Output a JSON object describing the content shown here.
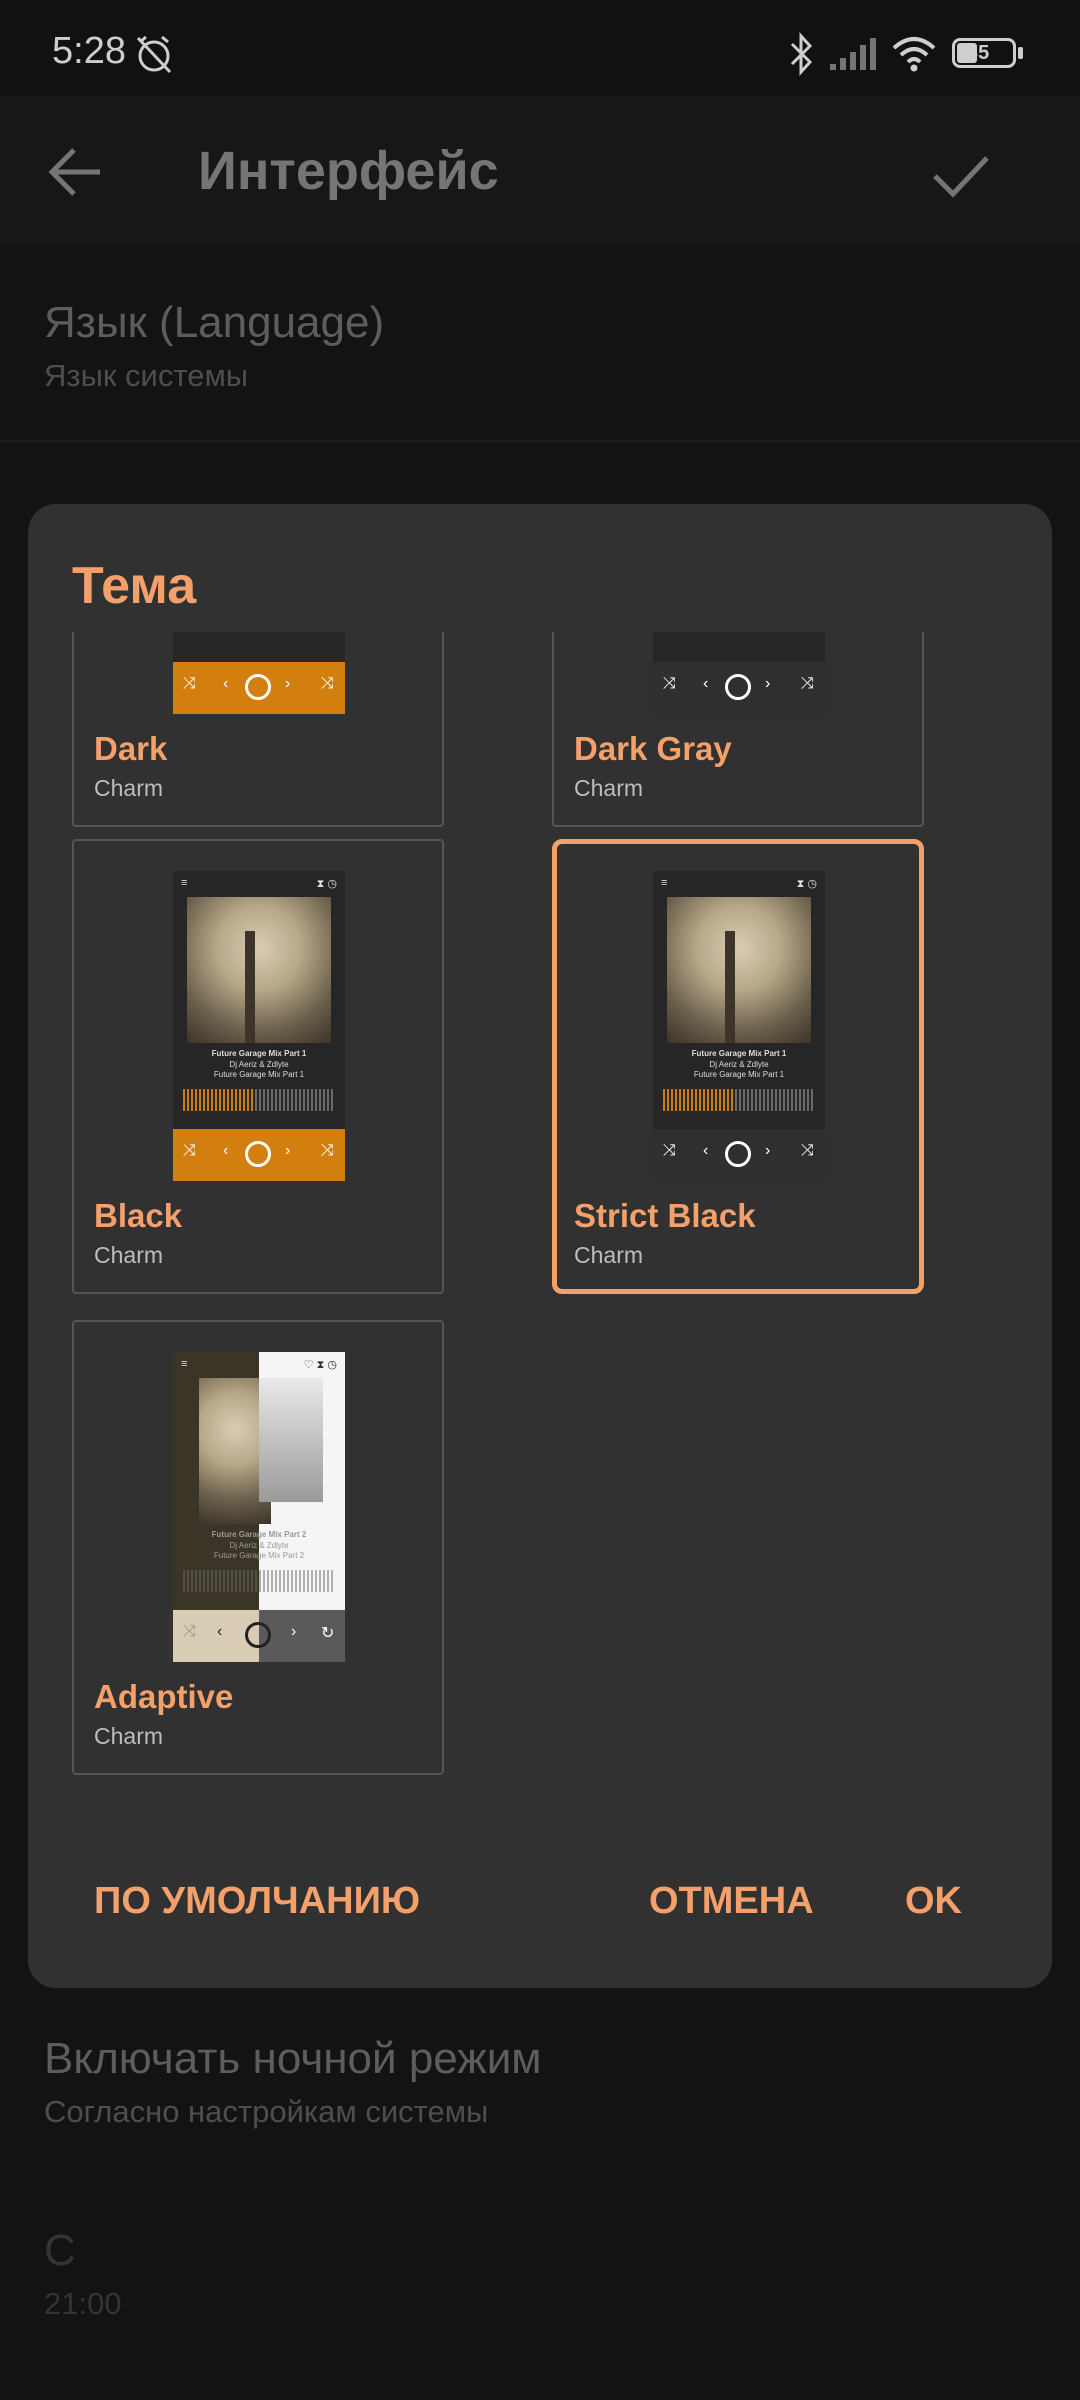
{
  "status_bar": {
    "time": "5:28",
    "battery": "35",
    "icons": [
      "alarm-off-icon",
      "bluetooth-icon",
      "signal-icon",
      "wifi-icon",
      "battery-icon"
    ]
  },
  "app_bar": {
    "title": "Интерфейс",
    "back_icon": "back-arrow-icon",
    "confirm_icon": "check-icon"
  },
  "settings": {
    "language_title": "Язык (Language)",
    "language_value": "Язык системы",
    "night_mode_title": "Включать ночной режим",
    "night_mode_value": "Согласно настройкам системы",
    "from_title": "С",
    "from_value": "21:00"
  },
  "dialog": {
    "title": "Тема",
    "themes": [
      {
        "name": "Dark",
        "author": "Charm",
        "selected": false
      },
      {
        "name": "Dark Gray",
        "author": "Charm",
        "selected": false
      },
      {
        "name": "Black",
        "author": "Charm",
        "selected": false
      },
      {
        "name": "Strict Black",
        "author": "Charm",
        "selected": true
      },
      {
        "name": "Adaptive",
        "author": "Charm",
        "selected": false
      }
    ],
    "preview": {
      "track_title": "Future Garage Mix Part 1",
      "artist": "Dj Aeriz & Zdlyte",
      "album": "Future Garage Mix Part 1",
      "adaptive_track_title": "Future Garage Mix Part 2",
      "adaptive_artist": "Dj Aeriz & Zdlyte",
      "adaptive_album": "Future Garage Mix Part 2"
    },
    "buttons": {
      "default": "ПО УМОЛЧАНИЮ",
      "cancel": "ОТМЕНА",
      "ok": "OK"
    }
  },
  "colors": {
    "accent": "#f3a06a",
    "dialog_bg": "#313131",
    "background": "#171717",
    "theme_orange": "#d37f10"
  }
}
